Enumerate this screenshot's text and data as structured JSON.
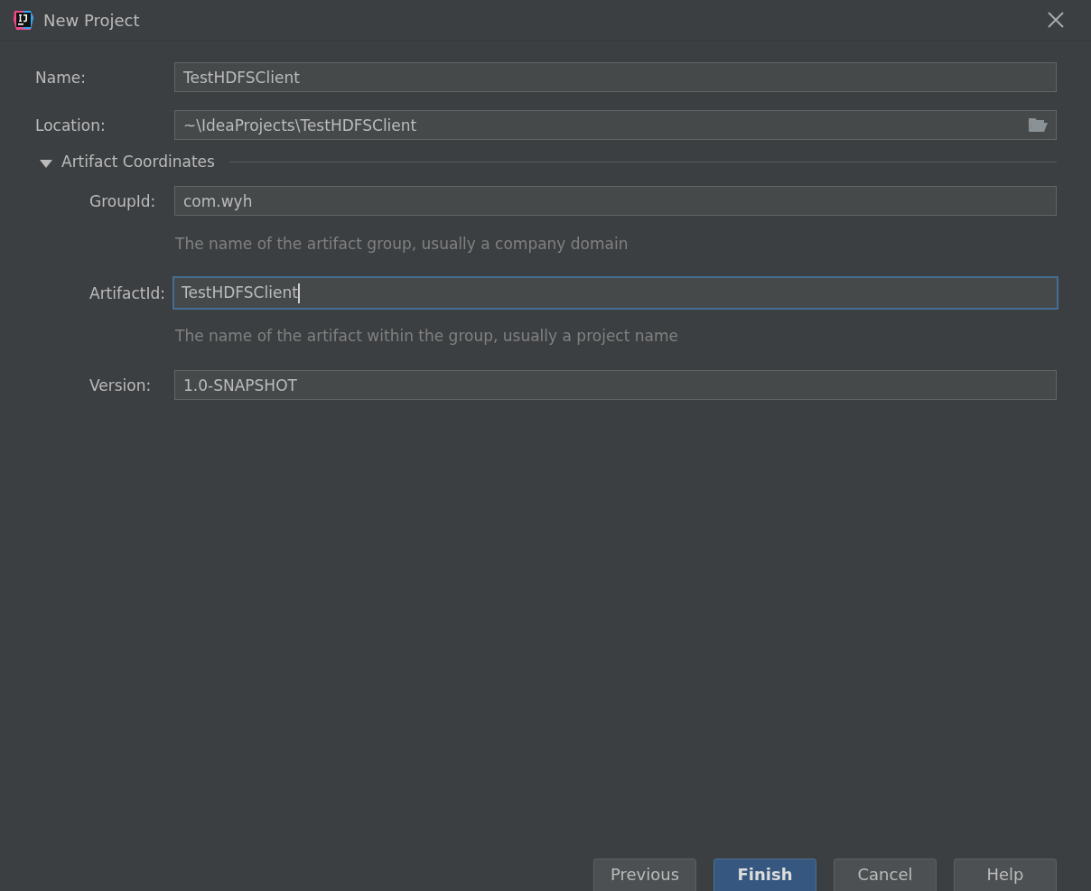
{
  "window": {
    "title": "New Project"
  },
  "fields": [
    {
      "label": "Name:",
      "value": "TestHDFSClient",
      "focused": false,
      "browse": false
    },
    {
      "label": "Location:",
      "value": "~\\IdeaProjects\\TestHDFSClient",
      "focused": false,
      "browse": true
    }
  ],
  "section": {
    "title": "Artifact Coordinates",
    "expanded": true,
    "fields": [
      {
        "label": "GroupId:",
        "value": "com.wyh",
        "focused": false,
        "hint": "The name of the artifact group, usually a company domain"
      },
      {
        "label": "ArtifactId:",
        "value": "TestHDFSClient",
        "focused": true,
        "hint": "The name of the artifact within the group, usually a project name"
      },
      {
        "label": "Version:",
        "value": "1.0-SNAPSHOT",
        "focused": false
      }
    ]
  },
  "buttons": [
    {
      "label": "Previous",
      "default": false
    },
    {
      "label": "Finish",
      "default": true
    },
    {
      "label": "Cancel",
      "default": false
    },
    {
      "label": "Help",
      "default": false
    }
  ]
}
